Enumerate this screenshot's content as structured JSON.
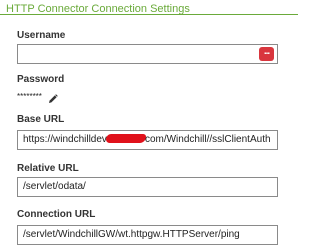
{
  "panel": {
    "title": "HTTP Connector Connection Settings"
  },
  "fields": {
    "username_label": "Username",
    "username_value": "",
    "username_menu_icon": "more-horizontal-icon",
    "password_label": "Password",
    "password_mask": "********",
    "password_edit_icon": "pencil-icon",
    "base_url_label": "Base URL",
    "base_url_prefix": "https://windchilldev",
    "base_url_suffix": "com/Windchill//sslClientAuth",
    "relative_url_label": "Relative URL",
    "relative_url_value": "/servlet/odata/",
    "connection_url_label": "Connection URL",
    "connection_url_value": "/servlet/WindchillGW/wt.httpgw.HTTPServer/ping"
  },
  "colors": {
    "accent": "#6aaa3a",
    "menu_button": "#d9363e",
    "redaction": "#e0111b"
  }
}
